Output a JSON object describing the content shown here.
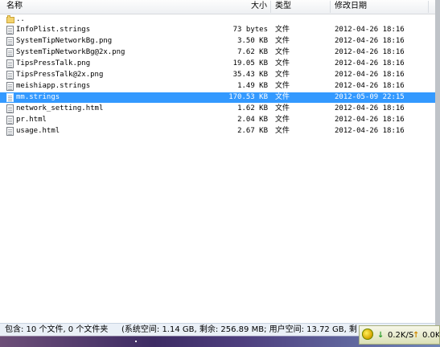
{
  "header": {
    "name": "名称",
    "size": "大小",
    "type": "类型",
    "modified": "修改日期"
  },
  "parent_row": {
    "name": ".."
  },
  "files": [
    {
      "name": "InfoPlist.strings",
      "size": "73 bytes",
      "type": "文件",
      "modified": "2012-04-26 18:16"
    },
    {
      "name": "SystemTipNetworkBg.png",
      "size": "3.50 KB",
      "type": "文件",
      "modified": "2012-04-26 18:16"
    },
    {
      "name": "SystemTipNetworkBg@2x.png",
      "size": "7.62 KB",
      "type": "文件",
      "modified": "2012-04-26 18:16"
    },
    {
      "name": "TipsPressTalk.png",
      "size": "19.05 KB",
      "type": "文件",
      "modified": "2012-04-26 18:16"
    },
    {
      "name": "TipsPressTalk@2x.png",
      "size": "35.43 KB",
      "type": "文件",
      "modified": "2012-04-26 18:16"
    },
    {
      "name": "meishiapp.strings",
      "size": "1.49 KB",
      "type": "文件",
      "modified": "2012-04-26 18:16"
    },
    {
      "name": "mm.strings",
      "size": "170.53 KB",
      "type": "文件",
      "modified": "2012-05-09 22:15",
      "selected": true
    },
    {
      "name": "network_setting.html",
      "size": "1.62 KB",
      "type": "文件",
      "modified": "2012-04-26 18:16"
    },
    {
      "name": "pr.html",
      "size": "2.04 KB",
      "type": "文件",
      "modified": "2012-04-26 18:16"
    },
    {
      "name": "usage.html",
      "size": "2.67 KB",
      "type": "文件",
      "modified": "2012-04-26 18:16"
    }
  ],
  "status": {
    "contents": "包含: 10 个文件, 0 个文件夹",
    "space": "(系统空间: 1.14 GB, 剩余: 256.89 MB; 用户空间: 13.72 GB, 剩"
  },
  "tray": {
    "download_speed": "0.2K/S",
    "upload_speed": "0.0K"
  },
  "colors": {
    "selection": "#3399ff",
    "statusbar": "#eaf0f7"
  }
}
